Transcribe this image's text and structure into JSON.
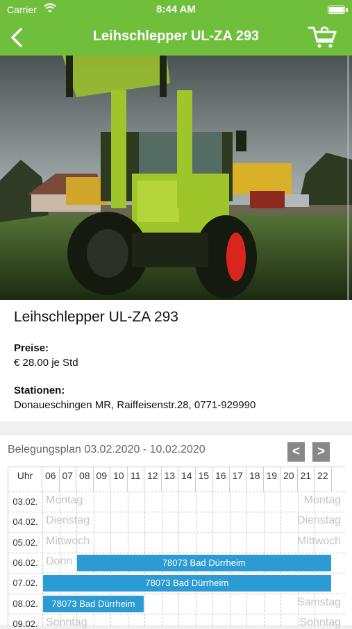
{
  "status_bar": {
    "carrier": "Carrier",
    "time": "8:44 AM"
  },
  "nav": {
    "title": "Leihschlepper UL-ZA 293"
  },
  "product": {
    "name": "Leihschlepper UL-ZA 293",
    "price_label": "Preise:",
    "price_value": "€ 28.00 je Std",
    "stations_label": "Stationen:",
    "stations_value": "Donaueschingen MR, Raiffeisenstr.28, 0771-929990"
  },
  "schedule": {
    "title": "Belegungsplan 03.02.2020 - 10.02.2020",
    "prev_label": "<",
    "next_label": ">",
    "hour_label": "Uhr",
    "hours": [
      "06",
      "07",
      "08",
      "09",
      "10",
      "11",
      "12",
      "13",
      "14",
      "15",
      "16",
      "17",
      "18",
      "19",
      "20",
      "21",
      "22"
    ],
    "rows": [
      {
        "date": "03.02.",
        "day_left": "Montag",
        "day_right": "Montag"
      },
      {
        "date": "04.02.",
        "day_left": "Dienstag",
        "day_right": "Dienstag"
      },
      {
        "date": "05.02.",
        "day_left": "Mittwoch",
        "day_right": "Mittwoch"
      },
      {
        "date": "06.02.",
        "day_left": "Donn",
        "day_right": ""
      },
      {
        "date": "07.02.",
        "day_left": "",
        "day_right": ""
      },
      {
        "date": "08.02.",
        "day_left": "",
        "day_right": "Samstag"
      },
      {
        "date": "09.02.",
        "day_left": "Sonntag",
        "day_right": "Sonntag"
      }
    ],
    "bookings": [
      {
        "row": 3,
        "start_hour": "08",
        "end_hour": "22",
        "label": "78073 Bad Dürrheim"
      },
      {
        "row": 4,
        "start_hour": "06",
        "end_hour": "22",
        "label": "78073 Bad Dürrheim"
      },
      {
        "row": 5,
        "start_hour": "06",
        "end_hour": "11",
        "label": "78073 Bad Dürrheim"
      }
    ]
  },
  "colors": {
    "brand_green": "#6fbf3c",
    "booking_blue": "#2c9ad3"
  }
}
